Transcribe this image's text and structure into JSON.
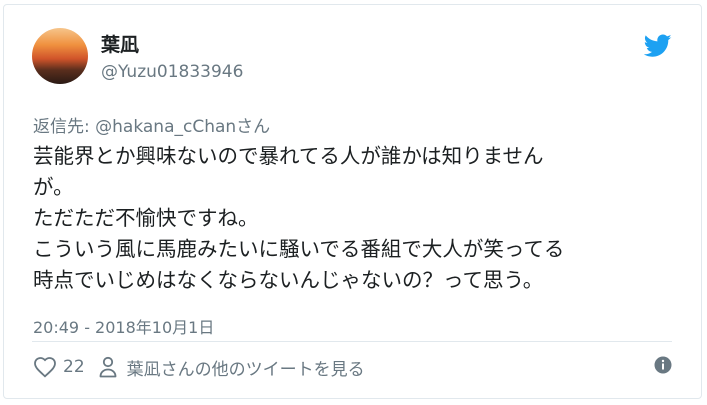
{
  "tweet": {
    "author_name": "葉凪",
    "author_handle": "@Yuzu01833946",
    "reply_prefix": "返信先: ",
    "reply_mention": "@hakana_cChan",
    "reply_suffix": "さん",
    "text_lines": [
      "芸能界とか興味ないので暴れてる人が誰かは知りません",
      "が。",
      "ただただ不愉快ですね。",
      "こういう風に馬鹿みたいに騒いでる番組で大人が笑ってる",
      "時点でいじめはなくならないんじゃないの？って思う。"
    ],
    "timestamp": "20:49 - 2018年10月1日",
    "like_count": "22",
    "more_tweets_label": "葉凪さんの他のツイートを見る"
  },
  "icons": {
    "logo": "twitter-bird-icon",
    "like": "heart-icon",
    "profile": "person-icon",
    "info": "info-icon"
  },
  "colors": {
    "brand": "#1da1f2",
    "muted_text": "#697882",
    "text": "#1c2022",
    "border": "#e1e8ed"
  }
}
